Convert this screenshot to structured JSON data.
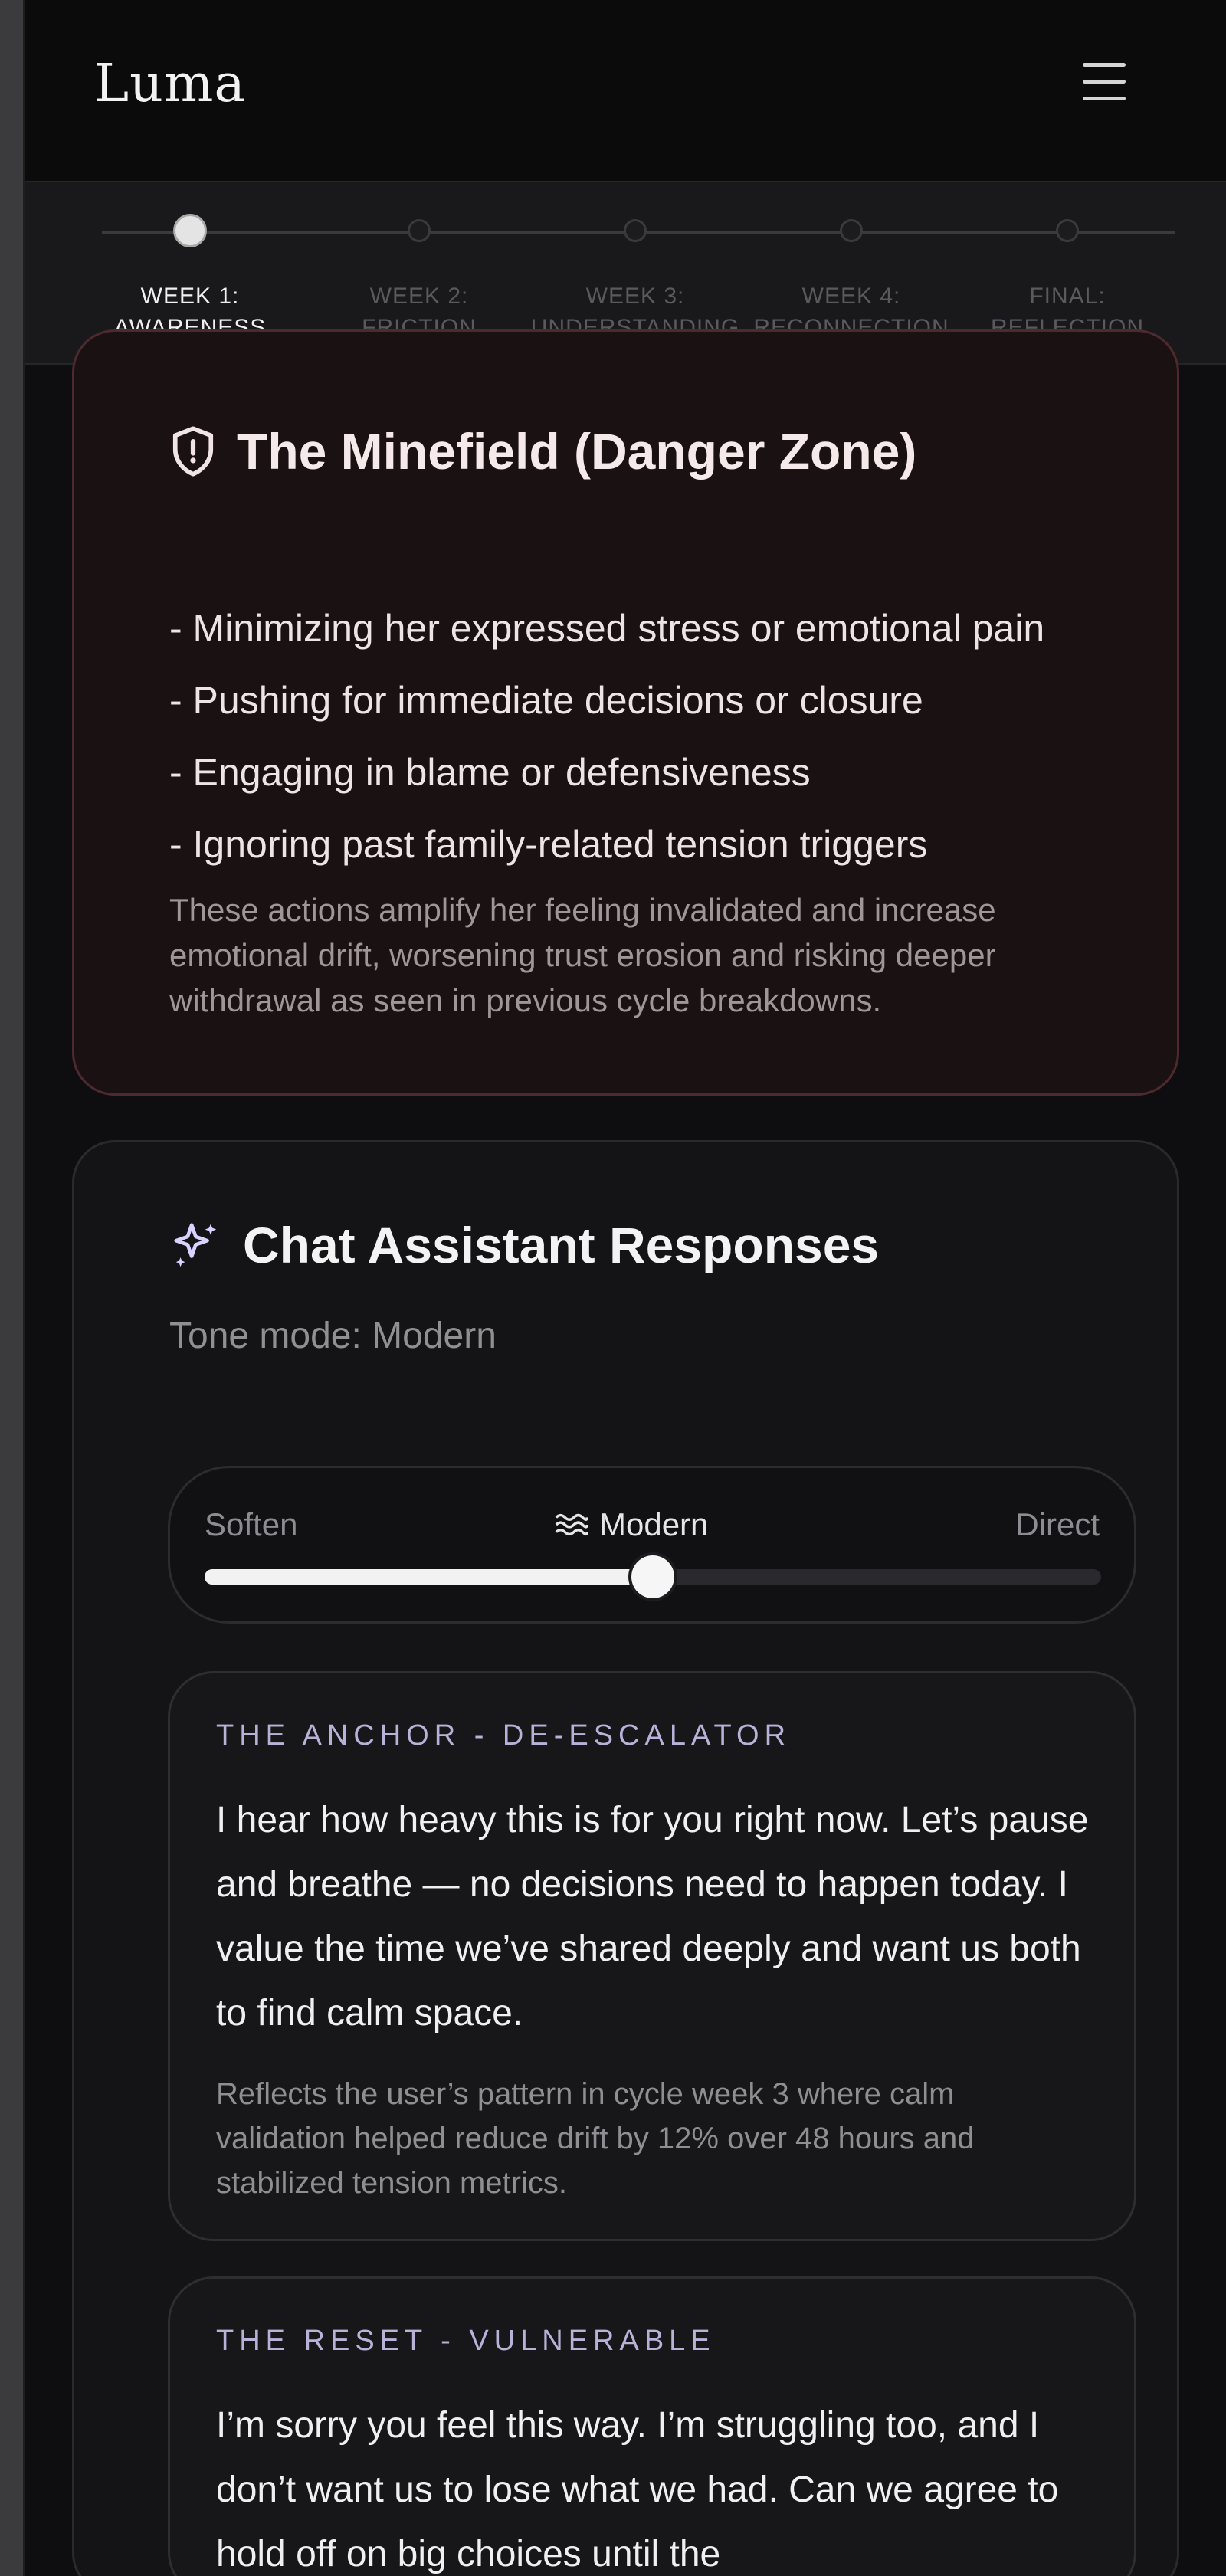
{
  "app": {
    "brand": "Luma"
  },
  "progress": {
    "steps": [
      {
        "line1": "WEEK 1:",
        "line2": "AWARENESS",
        "active": true
      },
      {
        "line1": "WEEK 2:",
        "line2": "FRICTION",
        "active": false
      },
      {
        "line1": "WEEK 3:",
        "line2": "UNDERSTANDING",
        "active": false
      },
      {
        "line1": "WEEK 4:",
        "line2": "RECONNECTION",
        "active": false
      },
      {
        "line1": "FINAL:",
        "line2": "REFLECTION",
        "active": false
      }
    ]
  },
  "danger": {
    "title": "The Minefield (Danger Zone)",
    "items": [
      "- Minimizing her expressed stress or emotional pain",
      "- Pushing for immediate decisions or closure",
      "- Engaging in blame or defensiveness",
      "- Ignoring past family-related tension triggers"
    ],
    "note": "These actions amplify her feeling invalidated and increase emotional drift, worsening trust erosion and risking deeper withdrawal as seen in previous cycle breakdowns."
  },
  "assistant": {
    "title": "Chat Assistant Responses",
    "tone_mode": "Tone mode: Modern",
    "slider": {
      "left": "Soften",
      "middle": "Modern",
      "right": "Direct",
      "value_fraction": 0.5
    },
    "responses": [
      {
        "heading": "THE ANCHOR - DE-ESCALATOR",
        "text": "I hear how heavy this is for you right now. Let’s pause and breathe — no decisions need to happen today. I value the time we’ve shared deeply and want us both to find calm space.",
        "note": "Reflects the user’s pattern in cycle week 3 where calm validation helped reduce drift by 12% over 48 hours and stabilized tension metrics."
      },
      {
        "heading": "THE RESET - VULNERABLE",
        "text": "I’m sorry you feel this way. I’m struggling too, and I don’t want us to lose what we had. Can we agree to hold off on big choices until the"
      }
    ]
  }
}
